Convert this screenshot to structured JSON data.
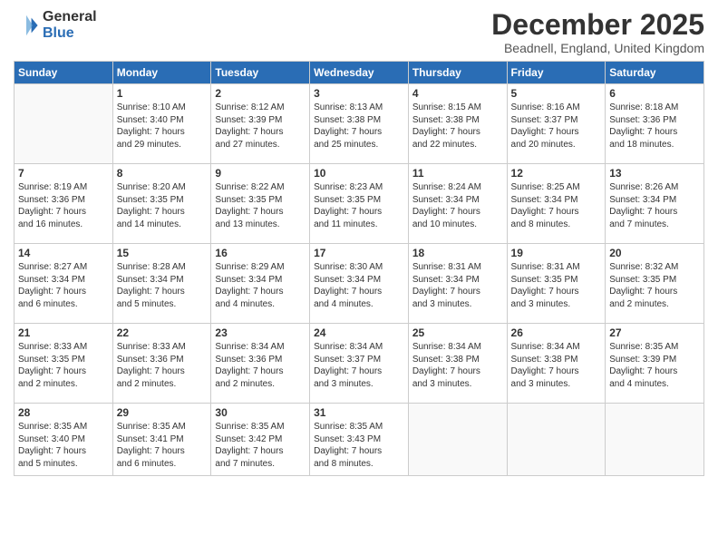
{
  "logo": {
    "general": "General",
    "blue": "Blue"
  },
  "header": {
    "month": "December 2025",
    "location": "Beadnell, England, United Kingdom"
  },
  "days_of_week": [
    "Sunday",
    "Monday",
    "Tuesday",
    "Wednesday",
    "Thursday",
    "Friday",
    "Saturday"
  ],
  "weeks": [
    [
      {
        "day": "",
        "info": ""
      },
      {
        "day": "1",
        "info": "Sunrise: 8:10 AM\nSunset: 3:40 PM\nDaylight: 7 hours\nand 29 minutes."
      },
      {
        "day": "2",
        "info": "Sunrise: 8:12 AM\nSunset: 3:39 PM\nDaylight: 7 hours\nand 27 minutes."
      },
      {
        "day": "3",
        "info": "Sunrise: 8:13 AM\nSunset: 3:38 PM\nDaylight: 7 hours\nand 25 minutes."
      },
      {
        "day": "4",
        "info": "Sunrise: 8:15 AM\nSunset: 3:38 PM\nDaylight: 7 hours\nand 22 minutes."
      },
      {
        "day": "5",
        "info": "Sunrise: 8:16 AM\nSunset: 3:37 PM\nDaylight: 7 hours\nand 20 minutes."
      },
      {
        "day": "6",
        "info": "Sunrise: 8:18 AM\nSunset: 3:36 PM\nDaylight: 7 hours\nand 18 minutes."
      }
    ],
    [
      {
        "day": "7",
        "info": "Sunrise: 8:19 AM\nSunset: 3:36 PM\nDaylight: 7 hours\nand 16 minutes."
      },
      {
        "day": "8",
        "info": "Sunrise: 8:20 AM\nSunset: 3:35 PM\nDaylight: 7 hours\nand 14 minutes."
      },
      {
        "day": "9",
        "info": "Sunrise: 8:22 AM\nSunset: 3:35 PM\nDaylight: 7 hours\nand 13 minutes."
      },
      {
        "day": "10",
        "info": "Sunrise: 8:23 AM\nSunset: 3:35 PM\nDaylight: 7 hours\nand 11 minutes."
      },
      {
        "day": "11",
        "info": "Sunrise: 8:24 AM\nSunset: 3:34 PM\nDaylight: 7 hours\nand 10 minutes."
      },
      {
        "day": "12",
        "info": "Sunrise: 8:25 AM\nSunset: 3:34 PM\nDaylight: 7 hours\nand 8 minutes."
      },
      {
        "day": "13",
        "info": "Sunrise: 8:26 AM\nSunset: 3:34 PM\nDaylight: 7 hours\nand 7 minutes."
      }
    ],
    [
      {
        "day": "14",
        "info": "Sunrise: 8:27 AM\nSunset: 3:34 PM\nDaylight: 7 hours\nand 6 minutes."
      },
      {
        "day": "15",
        "info": "Sunrise: 8:28 AM\nSunset: 3:34 PM\nDaylight: 7 hours\nand 5 minutes."
      },
      {
        "day": "16",
        "info": "Sunrise: 8:29 AM\nSunset: 3:34 PM\nDaylight: 7 hours\nand 4 minutes."
      },
      {
        "day": "17",
        "info": "Sunrise: 8:30 AM\nSunset: 3:34 PM\nDaylight: 7 hours\nand 4 minutes."
      },
      {
        "day": "18",
        "info": "Sunrise: 8:31 AM\nSunset: 3:34 PM\nDaylight: 7 hours\nand 3 minutes."
      },
      {
        "day": "19",
        "info": "Sunrise: 8:31 AM\nSunset: 3:35 PM\nDaylight: 7 hours\nand 3 minutes."
      },
      {
        "day": "20",
        "info": "Sunrise: 8:32 AM\nSunset: 3:35 PM\nDaylight: 7 hours\nand 2 minutes."
      }
    ],
    [
      {
        "day": "21",
        "info": "Sunrise: 8:33 AM\nSunset: 3:35 PM\nDaylight: 7 hours\nand 2 minutes."
      },
      {
        "day": "22",
        "info": "Sunrise: 8:33 AM\nSunset: 3:36 PM\nDaylight: 7 hours\nand 2 minutes."
      },
      {
        "day": "23",
        "info": "Sunrise: 8:34 AM\nSunset: 3:36 PM\nDaylight: 7 hours\nand 2 minutes."
      },
      {
        "day": "24",
        "info": "Sunrise: 8:34 AM\nSunset: 3:37 PM\nDaylight: 7 hours\nand 3 minutes."
      },
      {
        "day": "25",
        "info": "Sunrise: 8:34 AM\nSunset: 3:38 PM\nDaylight: 7 hours\nand 3 minutes."
      },
      {
        "day": "26",
        "info": "Sunrise: 8:34 AM\nSunset: 3:38 PM\nDaylight: 7 hours\nand 3 minutes."
      },
      {
        "day": "27",
        "info": "Sunrise: 8:35 AM\nSunset: 3:39 PM\nDaylight: 7 hours\nand 4 minutes."
      }
    ],
    [
      {
        "day": "28",
        "info": "Sunrise: 8:35 AM\nSunset: 3:40 PM\nDaylight: 7 hours\nand 5 minutes."
      },
      {
        "day": "29",
        "info": "Sunrise: 8:35 AM\nSunset: 3:41 PM\nDaylight: 7 hours\nand 6 minutes."
      },
      {
        "day": "30",
        "info": "Sunrise: 8:35 AM\nSunset: 3:42 PM\nDaylight: 7 hours\nand 7 minutes."
      },
      {
        "day": "31",
        "info": "Sunrise: 8:35 AM\nSunset: 3:43 PM\nDaylight: 7 hours\nand 8 minutes."
      },
      {
        "day": "",
        "info": ""
      },
      {
        "day": "",
        "info": ""
      },
      {
        "day": "",
        "info": ""
      }
    ]
  ]
}
